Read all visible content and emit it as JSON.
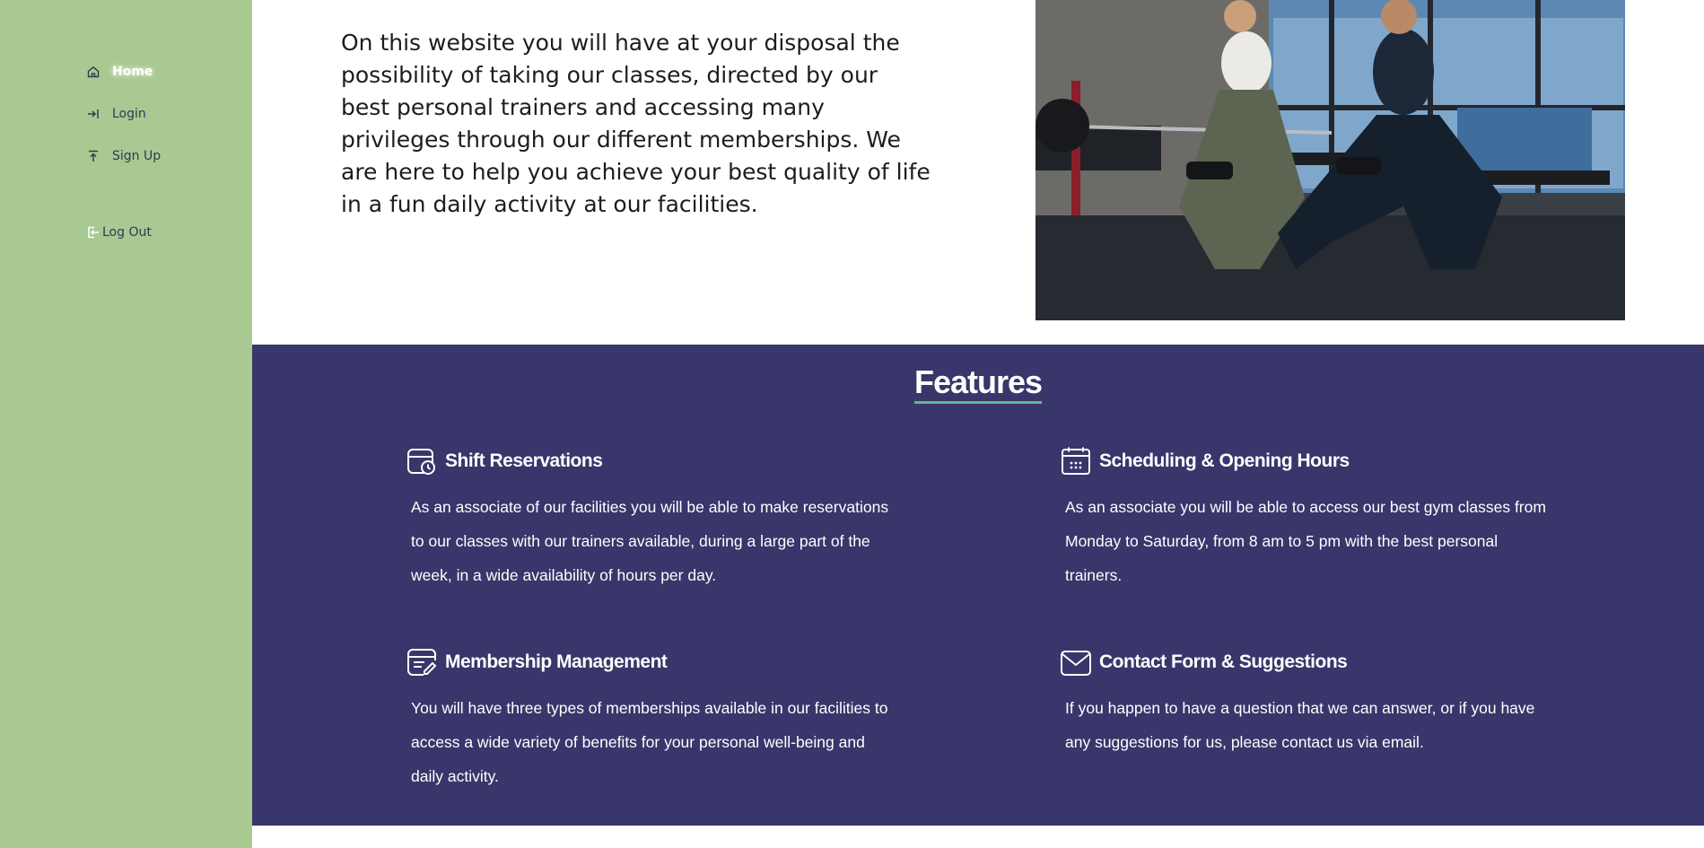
{
  "sidebar": {
    "items": [
      {
        "label": "Home",
        "icon": "home-icon"
      },
      {
        "label": "Login",
        "icon": "login-icon"
      },
      {
        "label": "Sign Up",
        "icon": "upload-icon"
      }
    ],
    "logout_label": "Log Out",
    "logout_icon": "logout-icon"
  },
  "intro": {
    "text": "On this website you will have at your disposal the possibility of taking our classes, directed by our best personal trainers and accessing many privileges through our different memberships. We are here to help you achieve your best quality of life in a fun daily activity at our facilities."
  },
  "features": {
    "title": "Features",
    "items": [
      {
        "title": "Shift Reservations",
        "icon": "calendar-clock-icon",
        "text": "As an associate of our facilities you will be able to make reservations to our classes with our trainers available, during a large part of the week, in a wide availability of hours per day."
      },
      {
        "title": "Scheduling & Opening Hours",
        "icon": "calendar-icon",
        "text": "As an associate you will be able to access our best gym classes from Monday to Saturday, from 8 am to 5 pm with the best personal trainers."
      },
      {
        "title": "Membership Management",
        "icon": "document-edit-icon",
        "text": "You will have three types of memberships available in our facilities to access a wide variety of benefits for your personal well-being and daily activity."
      },
      {
        "title": "Contact Form & Suggestions",
        "icon": "envelope-icon",
        "text": "If you happen to have a question that we can answer, or if you have any suggestions for us, please contact us via email."
      }
    ]
  },
  "colors": {
    "sidebar": "#a8c992",
    "features_bg": "#38366a",
    "accent": "#5fb88f",
    "nav_text": "#2f3a52"
  }
}
